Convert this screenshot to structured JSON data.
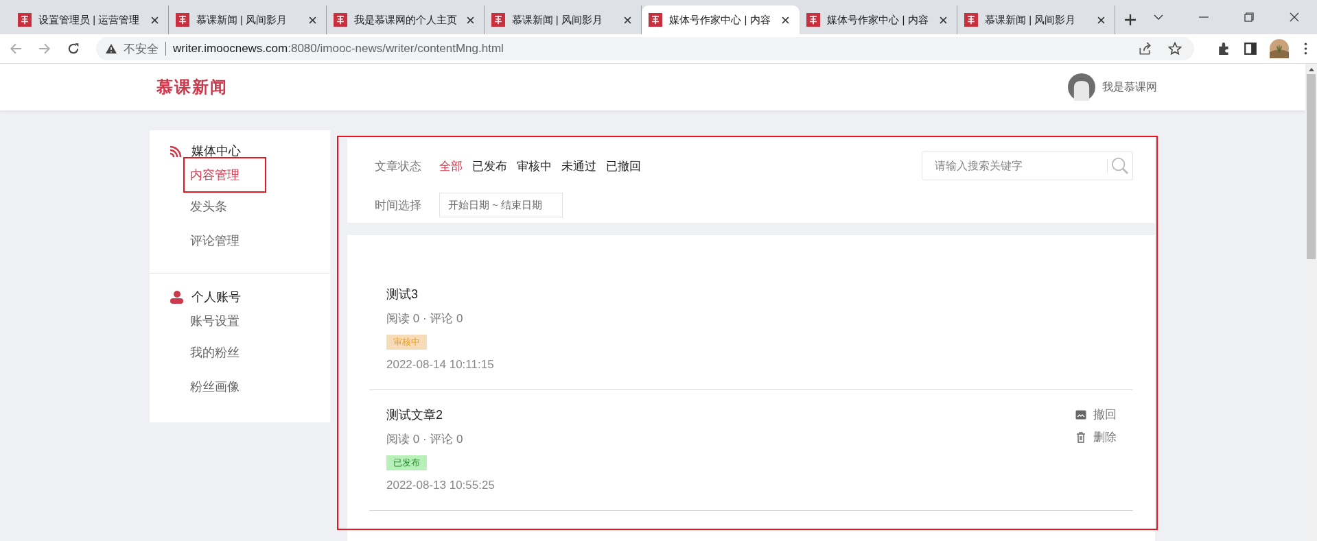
{
  "browser": {
    "tabs": [
      {
        "title": "设置管理员 | 运营管理",
        "selected": false
      },
      {
        "title": "慕课新闻 | 风间影月",
        "selected": false
      },
      {
        "title": "我是慕课网的个人主页",
        "selected": false
      },
      {
        "title": "慕课新闻 | 风间影月",
        "selected": false
      },
      {
        "title": "媒体号作家中心 | 内容",
        "selected": true
      },
      {
        "title": "媒体号作家中心 | 内容",
        "selected": false
      },
      {
        "title": "慕课新闻 | 风间影月",
        "selected": false
      }
    ],
    "security": "不安全",
    "url_host": "writer.imoocnews.com",
    "url_rest": ":8080/imooc-news/writer/contentMng.html"
  },
  "header": {
    "logo": "慕课新闻",
    "user_name": "我是慕课网"
  },
  "sidebar": {
    "sections": [
      {
        "title": "媒体中心",
        "kind": "feed",
        "items": [
          {
            "label": "内容管理",
            "selected": true
          },
          {
            "label": "发头条",
            "selected": false
          },
          {
            "label": "评论管理",
            "selected": false
          }
        ]
      },
      {
        "title": "个人账号",
        "kind": "person",
        "items": [
          {
            "label": "账号设置",
            "selected": false
          },
          {
            "label": "我的粉丝",
            "selected": false
          },
          {
            "label": "粉丝画像",
            "selected": false
          }
        ]
      }
    ]
  },
  "filters": {
    "status_label": "文章状态",
    "statuses": [
      {
        "label": "全部",
        "selected": true
      },
      {
        "label": "已发布",
        "selected": false
      },
      {
        "label": "审核中",
        "selected": false
      },
      {
        "label": "未通过",
        "selected": false
      },
      {
        "label": "已撤回",
        "selected": false
      }
    ],
    "time_label": "时间选择",
    "date_range": "开始日期 ~ 结束日期",
    "search": {
      "placeholder": "请输入搜索关键字"
    }
  },
  "articles": [
    {
      "title": "测试3",
      "stats": "阅读 0 · 评论 0",
      "status": {
        "label": "审核中",
        "kind": "reviewing"
      },
      "date": "2022-08-14 10:11:15"
    },
    {
      "title": "测试文章2",
      "stats": "阅读 0 · 评论 0",
      "status": {
        "label": "已发布",
        "kind": "published"
      },
      "date": "2022-08-13 10:55:25",
      "actions": [
        {
          "label": "撤回",
          "kind": "withdraw"
        },
        {
          "label": "删除",
          "kind": "delete"
        }
      ]
    }
  ]
}
